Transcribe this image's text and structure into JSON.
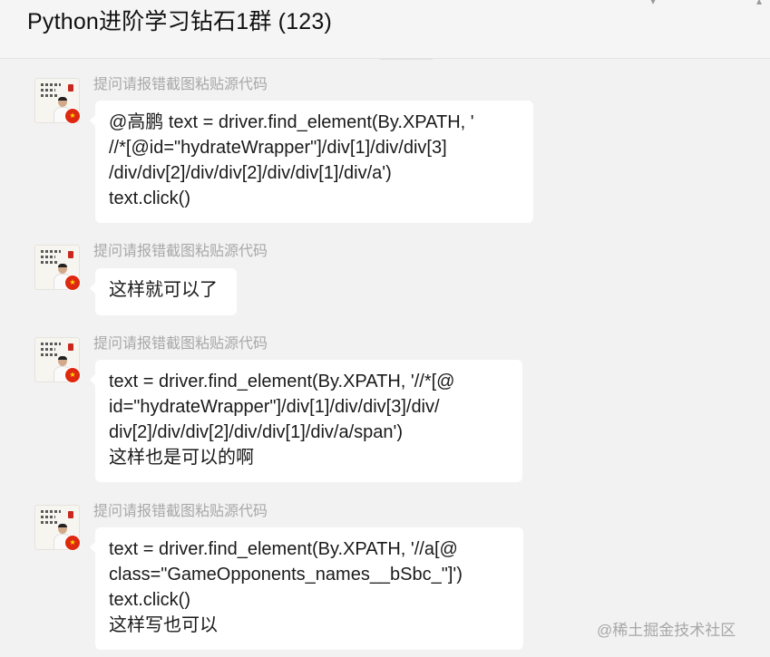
{
  "header": {
    "title": "Python进阶学习钻石1群 (123)"
  },
  "messages": [
    {
      "sender": "提问请报错截图粘贴源代码",
      "lines": [
        "@高鹏 text = driver.find_element(By.XPATH, '",
        "//*[@id=\"hydrateWrapper\"]/div[1]/div/div[3]",
        "/div/div[2]/div/div[2]/div/div[1]/div/a')",
        "text.click()"
      ]
    },
    {
      "sender": "提问请报错截图粘贴源代码",
      "lines": [
        "这样就可以了"
      ]
    },
    {
      "sender": "提问请报错截图粘贴源代码",
      "lines": [
        "text = driver.find_element(By.XPATH, '//*[@",
        "id=\"hydrateWrapper\"]/div[1]/div/div[3]/div/",
        "div[2]/div/div[2]/div/div[1]/div/a/span')",
        "这样也是可以的啊"
      ]
    },
    {
      "sender": "提问请报错截图粘贴源代码",
      "lines": [
        "text = driver.find_element(By.XPATH, '//a[@",
        "class=\"GameOpponents_names__bSbc_\"]')",
        "text.click()",
        "这样写也可以"
      ]
    }
  ],
  "watermark": "@稀土掘金技术社区",
  "icons": {
    "avatar": "calligraphy-portrait-avatar",
    "badge": "china-flag-badge-icon"
  },
  "colors": {
    "background": "#f2f2f2",
    "bubble": "#ffffff",
    "sender_text": "#a8a8a8",
    "flag_red": "#de2910"
  }
}
